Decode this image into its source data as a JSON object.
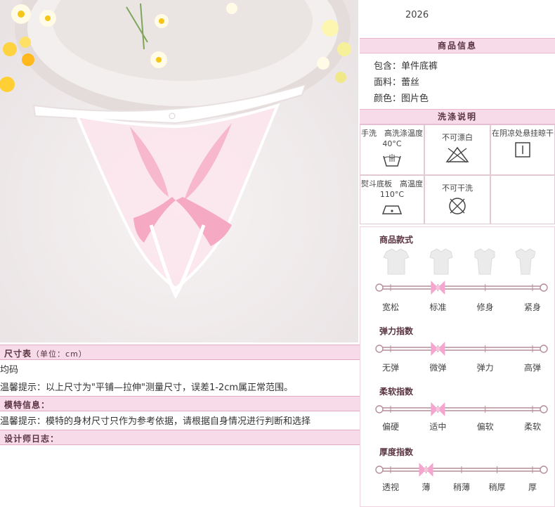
{
  "product_code": "2026",
  "product_info": {
    "title": "商品信息",
    "rows": [
      {
        "label": "包含：",
        "value": "单件底裤"
      },
      {
        "label": "面料：",
        "value": "蕾丝"
      },
      {
        "label": "颜色：",
        "value": "图片色"
      }
    ]
  },
  "washing": {
    "title": "洗涤说明",
    "cells": [
      {
        "text": "手洗　高洗涤温度40°C",
        "icon": "handwash-icon"
      },
      {
        "text": "不可漂白",
        "icon": "no-bleach-icon"
      },
      {
        "text": "在阴凉处悬挂晾干",
        "icon": "hang-dry-icon"
      },
      {
        "text": "熨斗底板　高温度110°C",
        "icon": "iron-icon"
      },
      {
        "text": "不可干洗",
        "icon": "no-dryclean-icon"
      },
      {
        "text": "",
        "icon": ""
      }
    ]
  },
  "style_section": {
    "title": "商品款式",
    "labels": [
      "宽松",
      "标准",
      "修身",
      "紧身"
    ],
    "selected_index": 1
  },
  "elasticity": {
    "title": "弹力指数",
    "labels": [
      "无弹",
      "微弹",
      "弹力",
      "高弹"
    ],
    "selected_index": 1
  },
  "softness": {
    "title": "柔软指数",
    "labels": [
      "偏硬",
      "适中",
      "偏软",
      "柔软"
    ],
    "selected_index": 1
  },
  "thickness": {
    "title": "厚度指数",
    "labels": [
      "透视",
      "薄",
      "稍薄",
      "稍厚",
      "厚"
    ],
    "selected_index": 1
  },
  "left_sections": {
    "size_title": "尺寸表",
    "size_unit": "（单位：cm）",
    "size_row": "均码",
    "size_tip": "温馨提示：以上尺寸为\"平铺—拉伸\"测量尺寸，误差1-2cm属正常范围。",
    "model_title": "模特信息：",
    "model_tip": "温馨提示：模特的身材尺寸只作为参考依据，请根据自身情况进行判断和选择",
    "designer_title": "设计师日志："
  },
  "colors": {
    "pink_bar": "#f7dbe9",
    "bow": "#f4a6cf",
    "scale_line": "#b58e99"
  }
}
